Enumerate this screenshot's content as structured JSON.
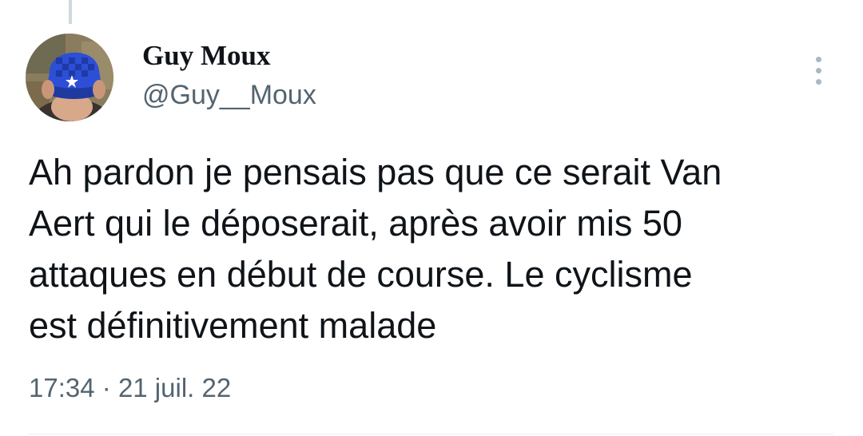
{
  "author": {
    "display_name": "Guy Moux",
    "handle": "@Guy__Moux",
    "avatar_icon": "profile-photo-blue-hat"
  },
  "menu": {
    "icon": "more-vertical-icon"
  },
  "tweet": {
    "text_lines": [
      "Ah pardon je pensais pas que ce serait Van",
      "Aert qui le déposerait, après avoir mis 50",
      "attaques en début de course. Le cyclisme",
      "est définitivement malade"
    ],
    "time": "17:34",
    "separator": "·",
    "date": "21 juil. 22"
  },
  "colors": {
    "text_primary": "#0f1419",
    "text_secondary": "#536471",
    "divider": "#cfd9de"
  }
}
